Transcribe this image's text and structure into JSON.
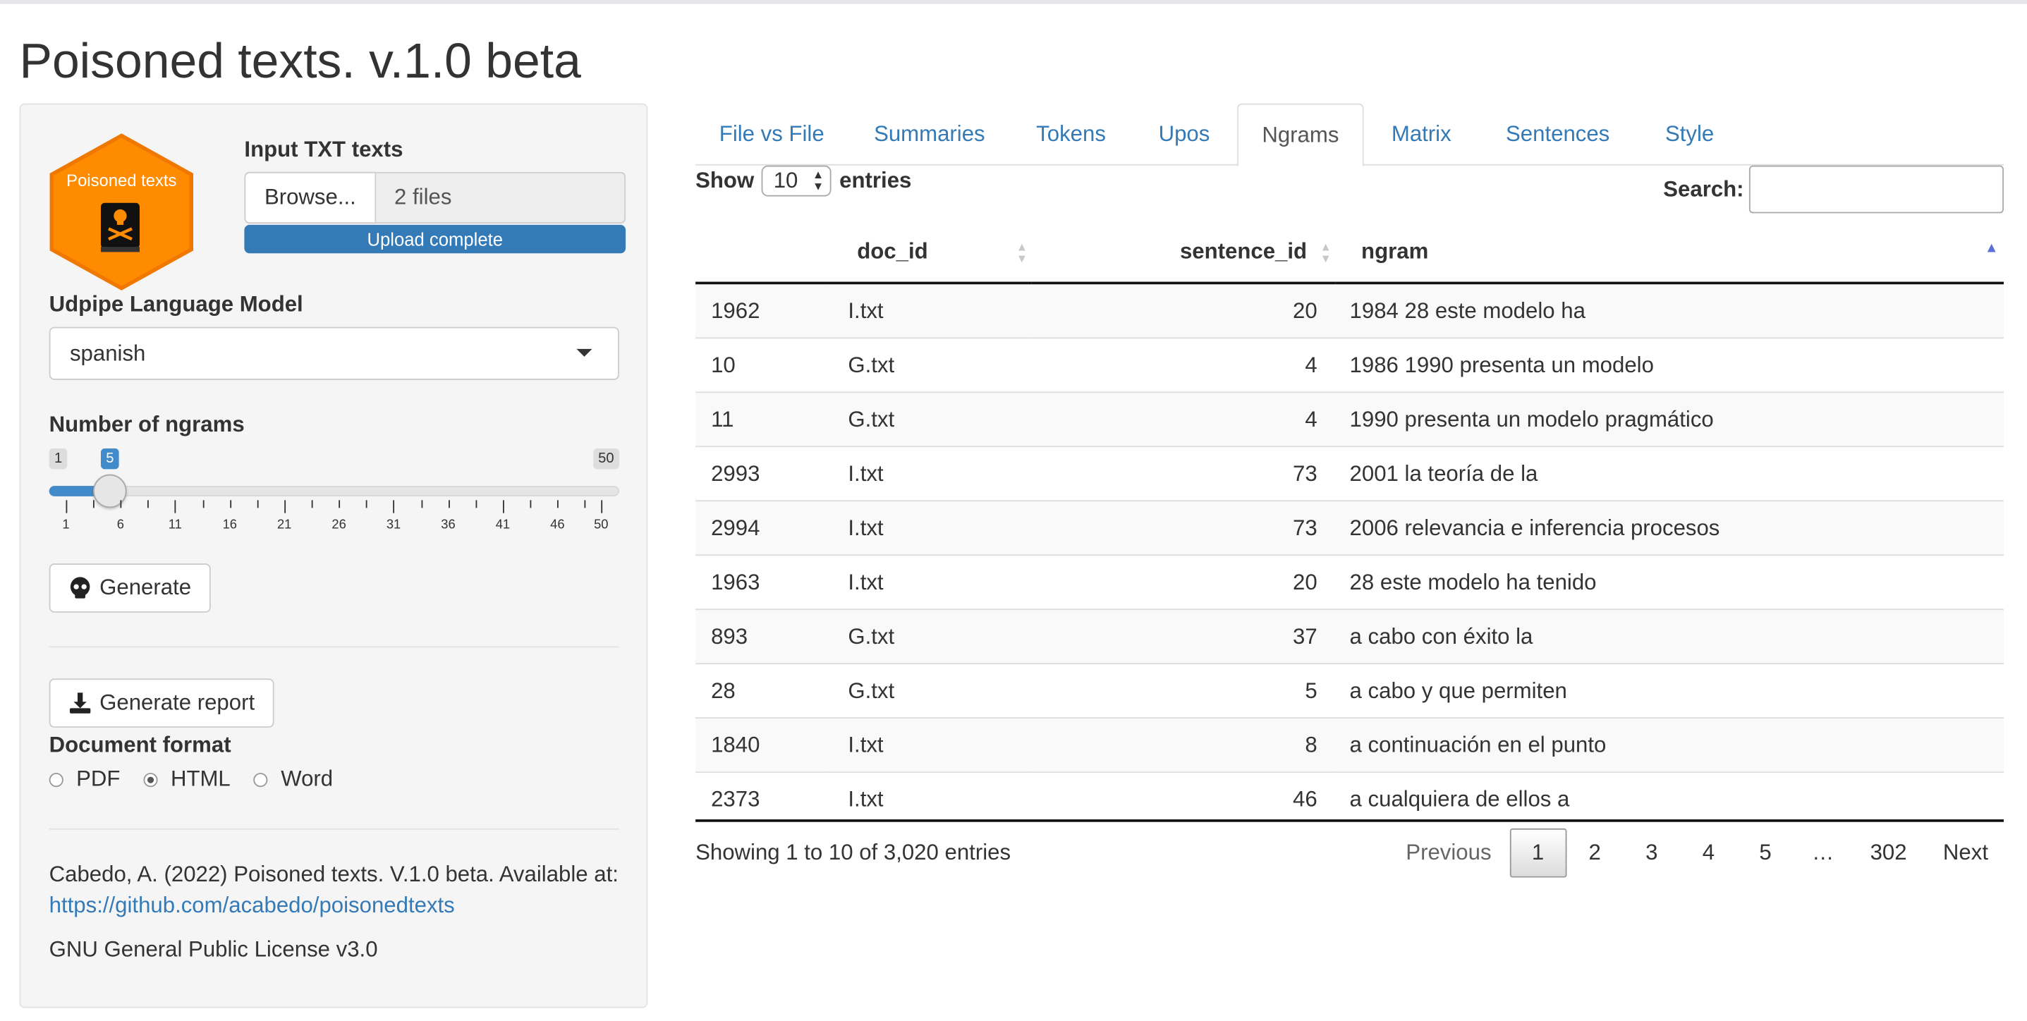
{
  "app": {
    "title": "Poisoned texts. v.1.0 beta"
  },
  "sidebar": {
    "logo": {
      "text": "Poisoned texts",
      "color": "#ff8c00",
      "icon": "skull-book-icon"
    },
    "upload": {
      "label": "Input TXT texts",
      "button": "Browse...",
      "value": "2 files",
      "progress": "Upload complete"
    },
    "model": {
      "label": "Udpipe Language Model",
      "selected": "spanish"
    },
    "ngrams": {
      "label": "Number of ngrams",
      "min": "1",
      "max": "50",
      "value": "5",
      "ticks": [
        "1",
        "6",
        "11",
        "16",
        "21",
        "26",
        "31",
        "36",
        "41",
        "46",
        "50"
      ]
    },
    "generate_label": "Generate",
    "report_label": "Generate report",
    "format": {
      "label": "Document format",
      "options": [
        "PDF",
        "HTML",
        "Word"
      ],
      "selected": "HTML"
    },
    "citation": "Cabedo, A. (2022) Poisoned texts. V.1.0 beta. Available at:",
    "link": "https://github.com/acabedo/poisonedtexts",
    "license": "GNU General Public License v3.0"
  },
  "tabs": [
    "File vs File",
    "Summaries",
    "Tokens",
    "Upos",
    "Ngrams",
    "Matrix",
    "Sentences",
    "Style"
  ],
  "active_tab": "Ngrams",
  "table": {
    "show_label": "Show",
    "length": "10",
    "entries_label": "entries",
    "search_label": "Search:",
    "columns": [
      "",
      "doc_id",
      "sentence_id",
      "ngram"
    ],
    "rows": [
      [
        "1962",
        "I.txt",
        "20",
        "1984 28 este modelo ha"
      ],
      [
        "10",
        "G.txt",
        "4",
        "1986 1990 presenta un modelo"
      ],
      [
        "11",
        "G.txt",
        "4",
        "1990 presenta un modelo pragmático"
      ],
      [
        "2993",
        "I.txt",
        "73",
        "2001 la teoría de la"
      ],
      [
        "2994",
        "I.txt",
        "73",
        "2006 relevancia e inferencia procesos"
      ],
      [
        "1963",
        "I.txt",
        "20",
        "28 este modelo ha tenido"
      ],
      [
        "893",
        "G.txt",
        "37",
        "a cabo con éxito la"
      ],
      [
        "28",
        "G.txt",
        "5",
        "a cabo y que permiten"
      ],
      [
        "1840",
        "I.txt",
        "8",
        "a continuación en el punto"
      ],
      [
        "2373",
        "I.txt",
        "46",
        "a cualquiera de ellos a"
      ]
    ],
    "info": "Showing 1 to 10 of 3,020 entries",
    "pagination": {
      "previous": "Previous",
      "pages": [
        "1",
        "2",
        "3",
        "4",
        "5",
        "…",
        "302"
      ],
      "next": "Next",
      "current": "1"
    }
  }
}
